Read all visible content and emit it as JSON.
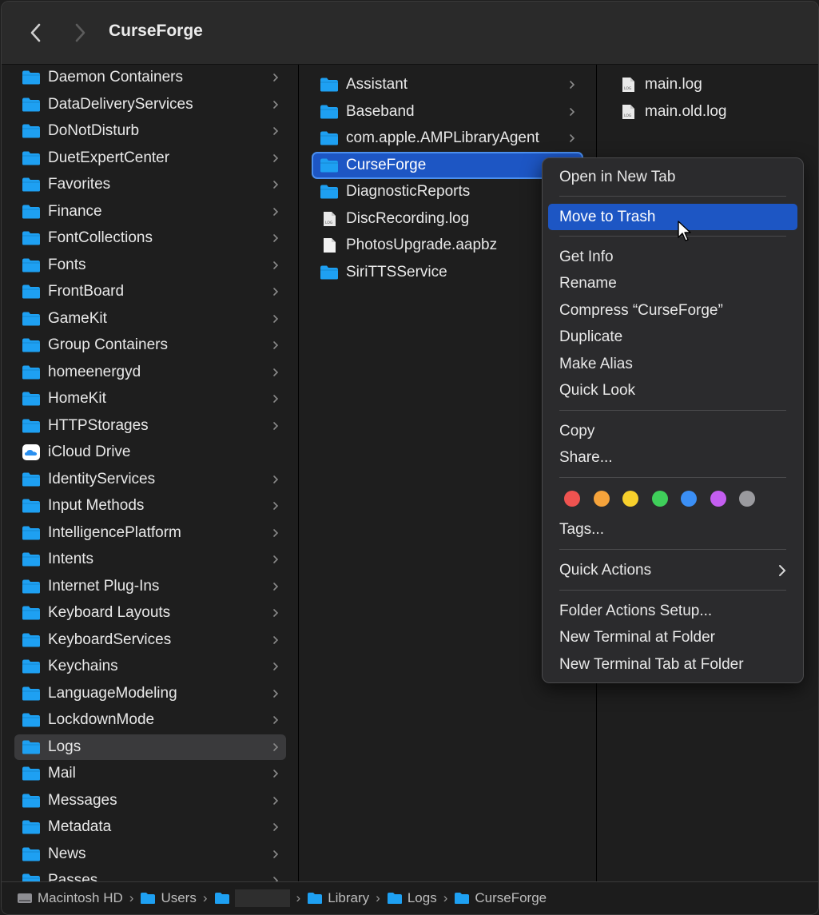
{
  "window": {
    "title": "CurseForge"
  },
  "sidebar_column": {
    "items": [
      {
        "label": "Daemon Containers",
        "icon": "folder-icon"
      },
      {
        "label": "DataDeliveryServices",
        "icon": "folder-icon"
      },
      {
        "label": "DoNotDisturb",
        "icon": "folder-icon"
      },
      {
        "label": "DuetExpertCenter",
        "icon": "folder-icon"
      },
      {
        "label": "Favorites",
        "icon": "folder-icon"
      },
      {
        "label": "Finance",
        "icon": "folder-icon"
      },
      {
        "label": "FontCollections",
        "icon": "folder-icon"
      },
      {
        "label": "Fonts",
        "icon": "folder-icon"
      },
      {
        "label": "FrontBoard",
        "icon": "folder-icon"
      },
      {
        "label": "GameKit",
        "icon": "folder-icon"
      },
      {
        "label": "Group Containers",
        "icon": "folder-icon"
      },
      {
        "label": "homeenergyd",
        "icon": "folder-icon"
      },
      {
        "label": "HomeKit",
        "icon": "folder-icon"
      },
      {
        "label": "HTTPStorages",
        "icon": "folder-icon"
      },
      {
        "label": "iCloud Drive",
        "icon": "icloud-icon"
      },
      {
        "label": "IdentityServices",
        "icon": "folder-icon"
      },
      {
        "label": "Input Methods",
        "icon": "folder-icon"
      },
      {
        "label": "IntelligencePlatform",
        "icon": "folder-icon"
      },
      {
        "label": "Intents",
        "icon": "folder-icon"
      },
      {
        "label": "Internet Plug-Ins",
        "icon": "folder-icon"
      },
      {
        "label": "Keyboard Layouts",
        "icon": "folder-icon"
      },
      {
        "label": "KeyboardServices",
        "icon": "folder-icon"
      },
      {
        "label": "Keychains",
        "icon": "folder-icon"
      },
      {
        "label": "LanguageModeling",
        "icon": "folder-icon"
      },
      {
        "label": "LockdownMode",
        "icon": "folder-icon"
      },
      {
        "label": "Logs",
        "icon": "folder-icon",
        "selected": true
      },
      {
        "label": "Mail",
        "icon": "folder-icon"
      },
      {
        "label": "Messages",
        "icon": "folder-icon"
      },
      {
        "label": "Metadata",
        "icon": "folder-icon"
      },
      {
        "label": "News",
        "icon": "folder-icon"
      },
      {
        "label": "Passes",
        "icon": "folder-icon"
      }
    ]
  },
  "logs_column": {
    "items": [
      {
        "label": "Assistant",
        "icon": "folder-icon",
        "chevron": true
      },
      {
        "label": "Baseband",
        "icon": "folder-icon",
        "chevron": true
      },
      {
        "label": "com.apple.AMPLibraryAgent",
        "icon": "folder-icon",
        "chevron": true
      },
      {
        "label": "CurseForge",
        "icon": "folder-icon",
        "chevron": true,
        "active": true
      },
      {
        "label": "DiagnosticReports",
        "icon": "folder-icon",
        "chevron": false
      },
      {
        "label": "DiscRecording.log",
        "icon": "log-file-icon",
        "chevron": false
      },
      {
        "label": "PhotosUpgrade.aapbz",
        "icon": "document-icon",
        "chevron": false
      },
      {
        "label": "SiriTTSService",
        "icon": "folder-icon",
        "chevron": false
      }
    ]
  },
  "curseforge_column": {
    "items": [
      {
        "label": "main.log",
        "icon": "log-file-icon"
      },
      {
        "label": "main.old.log",
        "icon": "log-file-icon"
      }
    ]
  },
  "context_menu": {
    "open_new_tab": "Open in New Tab",
    "move_to_trash": "Move to Trash",
    "get_info": "Get Info",
    "rename": "Rename",
    "compress": "Compress “CurseForge”",
    "duplicate": "Duplicate",
    "make_alias": "Make Alias",
    "quick_look": "Quick Look",
    "copy": "Copy",
    "share": "Share...",
    "tags": "Tags...",
    "quick_actions": "Quick Actions",
    "folder_actions_setup": "Folder Actions Setup...",
    "new_terminal": "New Terminal at Folder",
    "new_terminal_tab": "New Terminal Tab at Folder",
    "tag_colors": [
      "#ef5350",
      "#f5a33b",
      "#f7d02c",
      "#3fcf5a",
      "#3b8ff5",
      "#c45ef0",
      "#9a9a9e"
    ]
  },
  "path_bar": {
    "macintosh_hd": "Macintosh HD",
    "users": "Users",
    "library": "Library",
    "logs": "Logs",
    "curseforge": "CurseForge"
  },
  "colors": {
    "accent": "#1d56c4",
    "folder": "#1ea0f2"
  }
}
